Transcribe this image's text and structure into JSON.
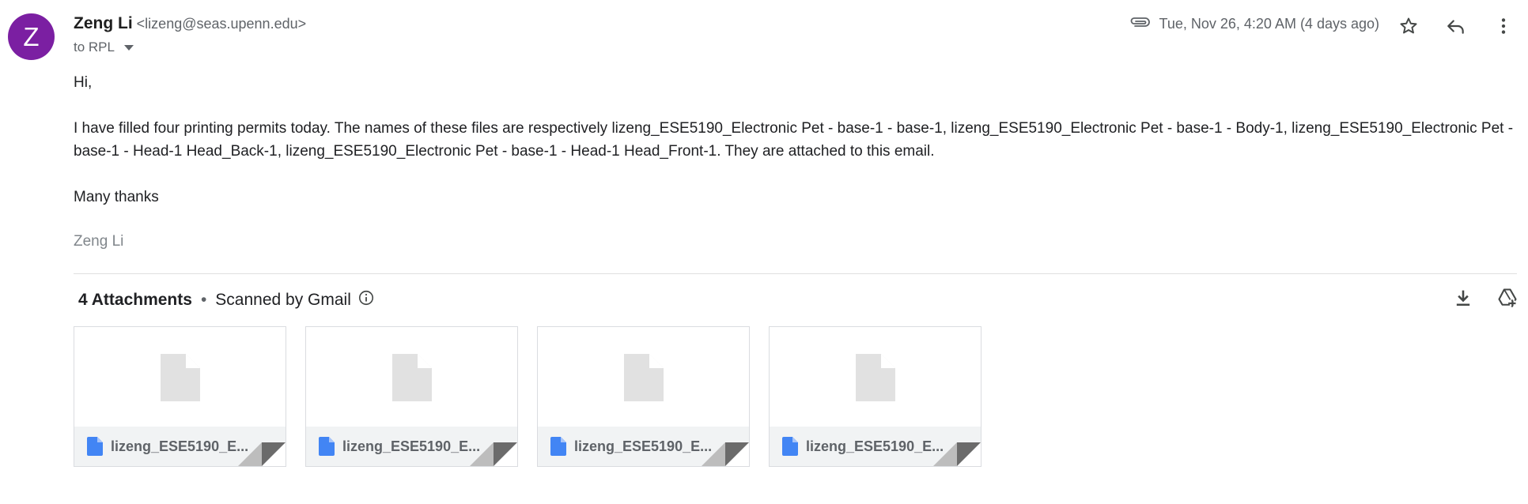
{
  "sender": {
    "initial": "Z",
    "name": "Zeng Li",
    "email": "<lizeng@seas.upenn.edu>",
    "to": "to RPL"
  },
  "header": {
    "date": "Tue, Nov 26, 4:20 AM (4 days ago)"
  },
  "message": {
    "greeting": "Hi,",
    "paragraph": "I have filled four printing permits today. The names of these files are respectively lizeng_ESE5190_Electronic Pet - base-1 - base-1, lizeng_ESE5190_Electronic Pet - base-1 - Body-1, lizeng_ESE5190_Electronic Pet - base-1 - Head-1 Head_Back-1, lizeng_ESE5190_Electronic Pet - base-1 - Head-1 Head_Front-1. They are attached to this email.",
    "closing": "Many thanks",
    "signature": "Zeng Li"
  },
  "attachments": {
    "count_label": "4 Attachments",
    "separator": "•",
    "scan_label": "Scanned by Gmail",
    "files": [
      {
        "name": "lizeng_ESE5190_E..."
      },
      {
        "name": "lizeng_ESE5190_E..."
      },
      {
        "name": "lizeng_ESE5190_E..."
      },
      {
        "name": "lizeng_ESE5190_E..."
      }
    ]
  },
  "colors": {
    "avatar": "#7b1fa2",
    "file_icon": "#4285f4"
  }
}
